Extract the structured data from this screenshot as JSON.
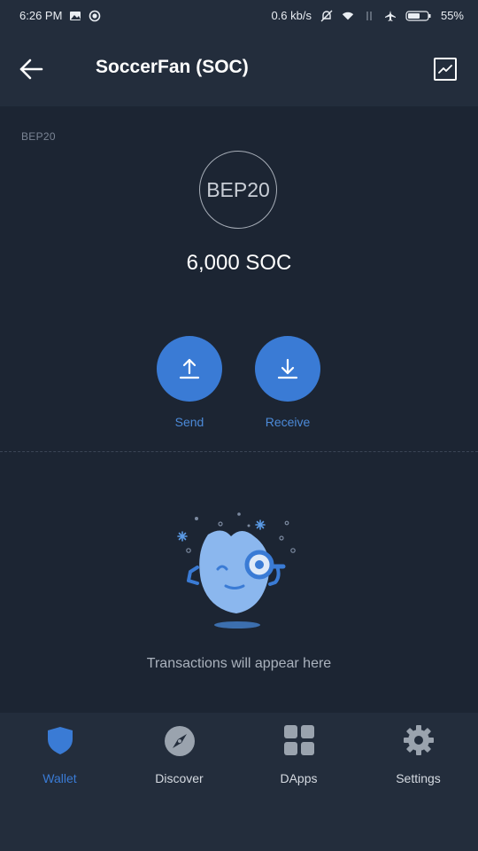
{
  "status_bar": {
    "time": "6:26 PM",
    "network_speed": "0.6 kb/s",
    "battery": "55%"
  },
  "header": {
    "title": "SoccerFan (SOC)",
    "back_icon": "arrow-left-icon",
    "chart_icon": "line-chart-icon"
  },
  "token": {
    "network": "BEP20",
    "logo_text": "BEP20",
    "balance": "6,000 SOC"
  },
  "actions": {
    "send_label": "Send",
    "receive_label": "Receive"
  },
  "empty_state": {
    "message": "Transactions will appear here"
  },
  "bottom_nav": {
    "items": [
      {
        "label": "Wallet",
        "icon": "shield-icon",
        "active": true
      },
      {
        "label": "Discover",
        "icon": "compass-icon",
        "active": false
      },
      {
        "label": "DApps",
        "icon": "grid-icon",
        "active": false
      },
      {
        "label": "Settings",
        "icon": "gear-icon",
        "active": false
      }
    ]
  },
  "colors": {
    "accent": "#3a7bd5",
    "background": "#1c2533",
    "bar": "#232d3c"
  }
}
